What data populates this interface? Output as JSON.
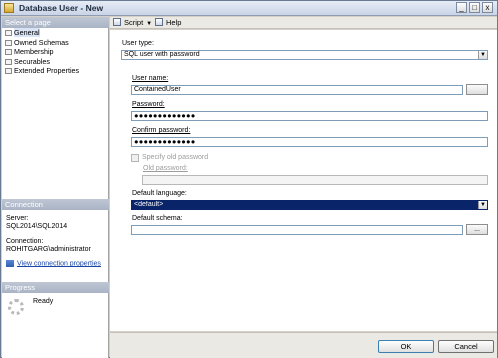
{
  "window": {
    "title": "Database User - New",
    "controls": {
      "minimize": "_",
      "maximize": "□",
      "close": "x"
    }
  },
  "left_pane": {
    "select_page_header": "Select a page",
    "pages": [
      "General",
      "Owned Schemas",
      "Membership",
      "Securables",
      "Extended Properties"
    ],
    "selected_page": "General",
    "connection_header": "Connection",
    "server_label": "Server:",
    "server_value": "SQL2014\\SQL2014",
    "connection_label": "Connection:",
    "connection_value": "ROHITGARG\\administrator",
    "view_connection_link": "View connection properties",
    "progress_header": "Progress",
    "progress_status": "Ready"
  },
  "toolbar": {
    "script_label": "Script",
    "help_label": "Help"
  },
  "form": {
    "user_type_label": "User type:",
    "user_type_value": "SQL user with password",
    "user_name_label": "User name:",
    "user_name_value": "ContainedUser",
    "password_label": "Password:",
    "password_value": "●●●●●●●●●●●●●",
    "confirm_password_label": "Confirm password:",
    "confirm_password_value": "●●●●●●●●●●●●●",
    "specify_old_password_label": "Specify old password",
    "old_password_label": "Old password:",
    "default_language_label": "Default language:",
    "default_language_value": "<default>",
    "default_schema_label": "Default schema:",
    "default_schema_value": "",
    "browse_label": "..."
  },
  "footer": {
    "ok_label": "OK",
    "cancel_label": "Cancel"
  }
}
